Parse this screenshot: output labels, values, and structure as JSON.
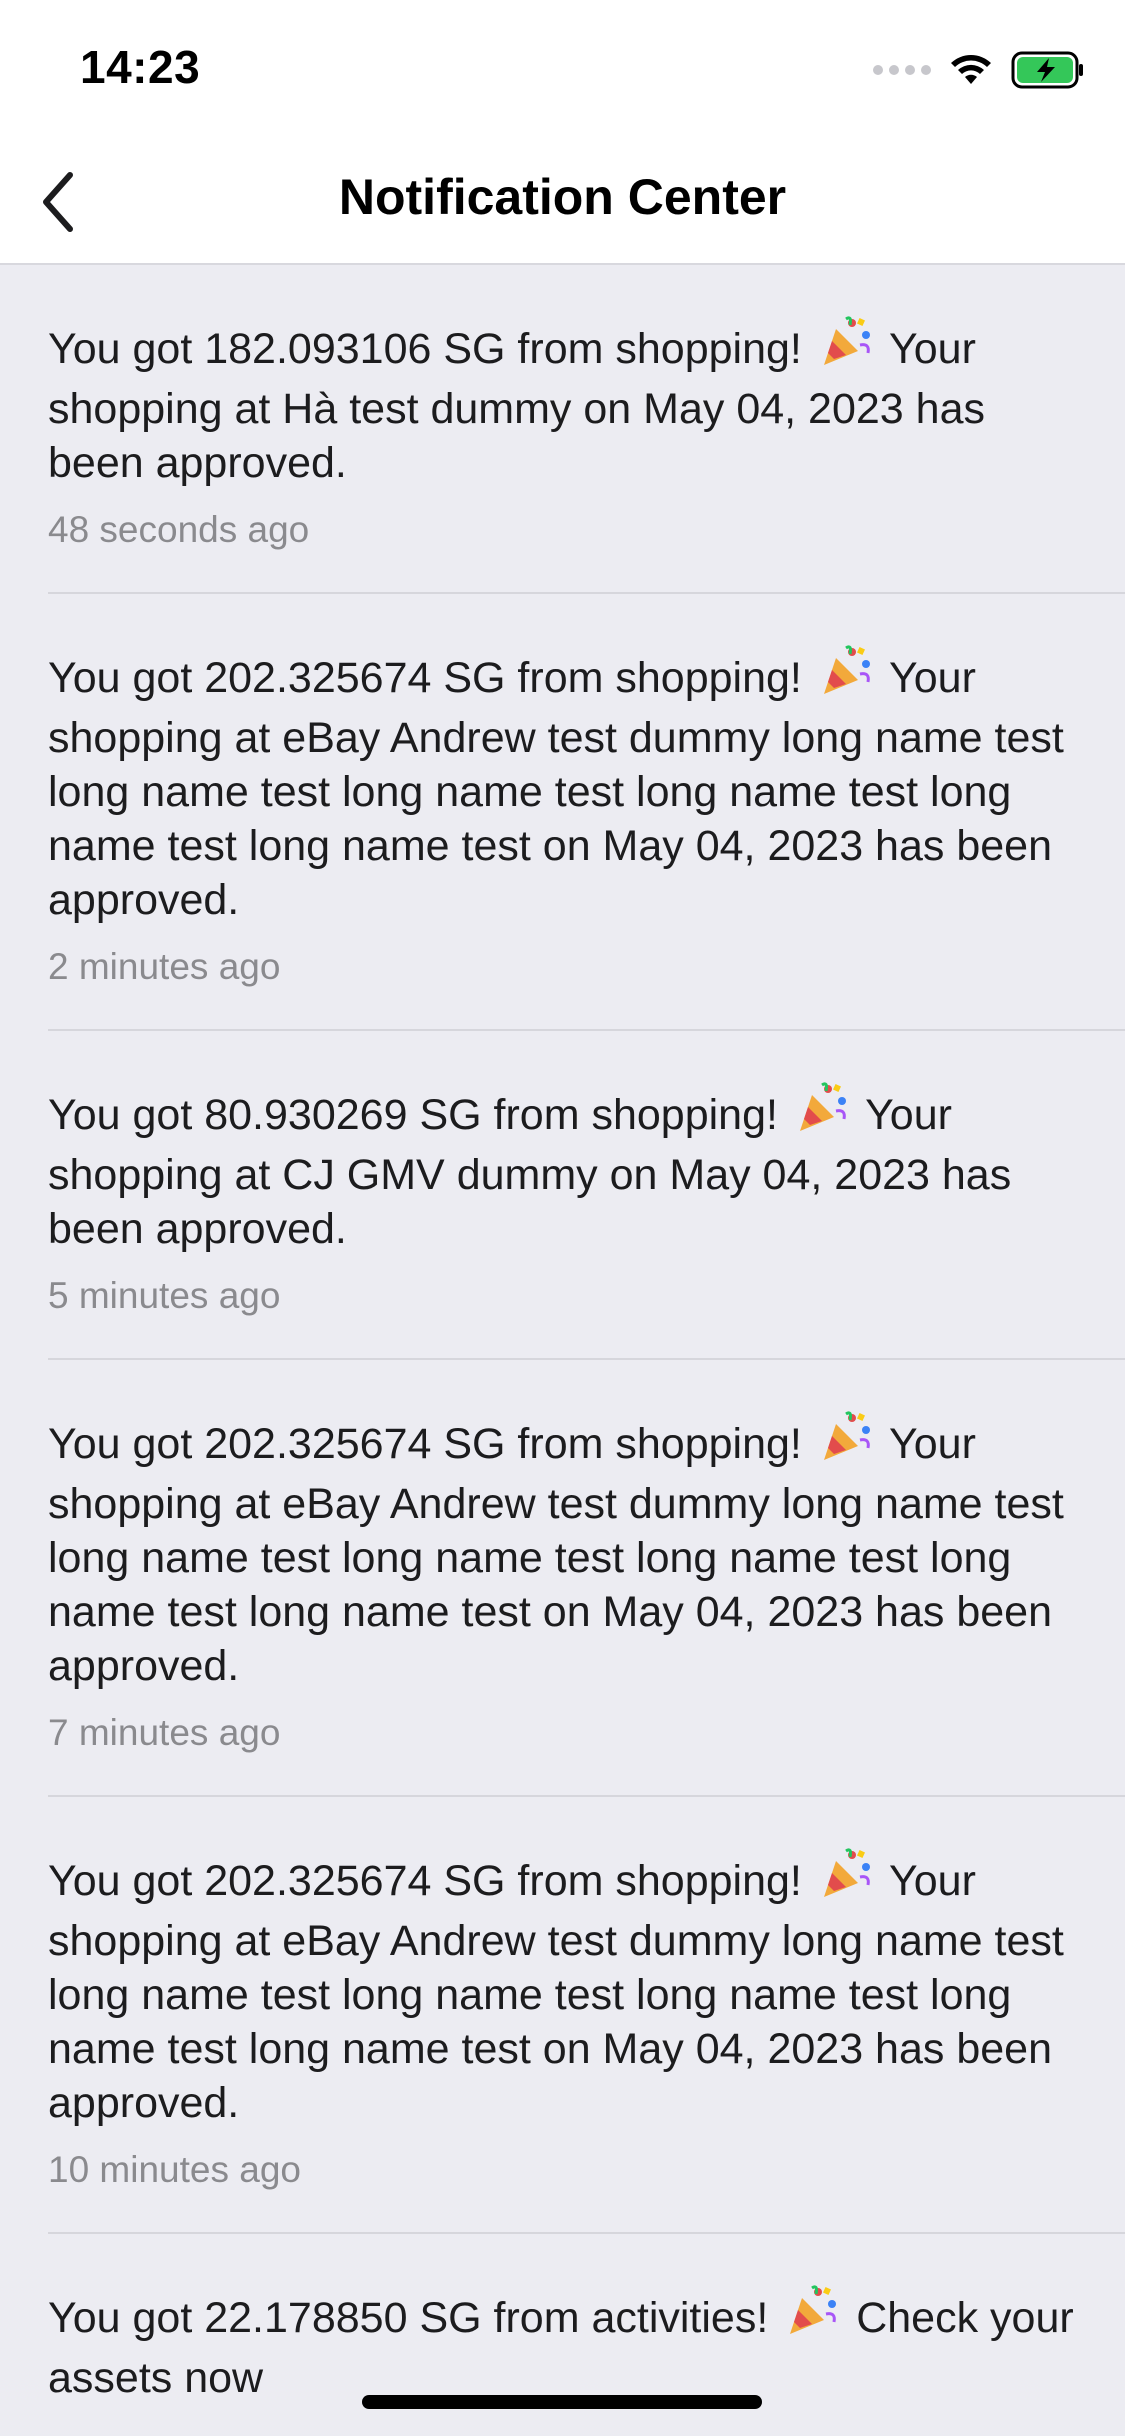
{
  "status_bar": {
    "time": "14:23"
  },
  "nav": {
    "title": "Notification Center"
  },
  "notifications": [
    {
      "pre": "You got 182.093106 SG from shopping!",
      "post": "Your shopping at Hà test dummy on May 04, 2023 has been approved.",
      "time": "48 seconds ago"
    },
    {
      "pre": "You got 202.325674 SG from shopping!",
      "post": "Your shopping at eBay Andrew test dummy long name test long name test long name test long name test long name test long name test on May 04, 2023 has been approved.",
      "time": "2 minutes ago"
    },
    {
      "pre": "You got 80.930269 SG from shopping!",
      "post": "Your shopping at CJ GMV dummy on May 04, 2023 has been approved.",
      "time": "5 minutes ago"
    },
    {
      "pre": "You got 202.325674 SG from shopping!",
      "post": "Your shopping at eBay Andrew test dummy long name test long name test long name test long name test long name test long name test on May 04, 2023 has been approved.",
      "time": "7 minutes ago"
    },
    {
      "pre": "You got 202.325674 SG from shopping!",
      "post": "Your shopping at eBay Andrew test dummy long name test long name test long name test long name test long name test long name test on May 04, 2023 has been approved.",
      "time": "10 minutes ago"
    },
    {
      "pre": "You got 22.178850 SG from activities!",
      "post": "Check your assets now",
      "time": ""
    }
  ],
  "colors": {
    "battery_green": "#34c759",
    "background": "#ececf2"
  }
}
